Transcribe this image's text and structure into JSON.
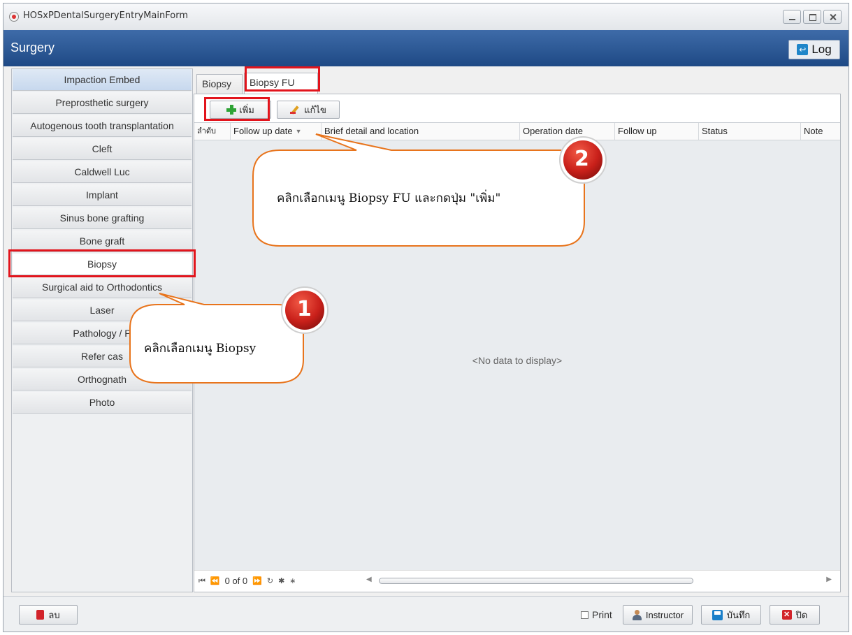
{
  "window": {
    "title": "HOSxPDentalSurgeryEntryMainForm"
  },
  "header": {
    "title": "Surgery",
    "log_label": "Log"
  },
  "sidebar": {
    "items": [
      {
        "label": "Impaction Embed"
      },
      {
        "label": "Preprosthetic surgery"
      },
      {
        "label": "Autogenous tooth transplantation"
      },
      {
        "label": "Cleft"
      },
      {
        "label": "Caldwell Luc"
      },
      {
        "label": "Implant"
      },
      {
        "label": "Sinus bone grafting"
      },
      {
        "label": "Bone graft"
      },
      {
        "label": "Biopsy"
      },
      {
        "label": "Surgical aid to Orthodontics"
      },
      {
        "label": "Laser"
      },
      {
        "label": "Pathology / P"
      },
      {
        "label": "Refer cas"
      },
      {
        "label": "Orthognath"
      },
      {
        "label": "Photo"
      }
    ],
    "active_index": 8
  },
  "tabs": [
    {
      "label": "Biopsy"
    },
    {
      "label": "Biopsy FU"
    }
  ],
  "active_tab": 1,
  "toolbar": {
    "add_label": "เพิ่ม",
    "edit_label": "แก้ไข"
  },
  "grid": {
    "columns": [
      {
        "label": "ลำดับ"
      },
      {
        "label": "Follow up date"
      },
      {
        "label": "Brief detail and location"
      },
      {
        "label": "Operation date"
      },
      {
        "label": "Follow up"
      },
      {
        "label": "Status"
      },
      {
        "label": "Note"
      }
    ],
    "empty_text": "<No data to display>",
    "page_info": "0 of 0"
  },
  "bottom": {
    "delete_label": "ลบ",
    "print_label": "Print",
    "instructor_label": "Instructor",
    "save_label": "บันทึก",
    "close_label": "ปิด"
  },
  "annotations": {
    "step1": {
      "number": "1",
      "text": "คลิกเลือกเมนู Biopsy"
    },
    "step2": {
      "number": "2",
      "text": "คลิกเลือกเมนู Biopsy FU และกดปุ่ม \"เพิ่ม\""
    },
    "highlight_color": "#e2141c",
    "badge_color": "#d6261f"
  }
}
